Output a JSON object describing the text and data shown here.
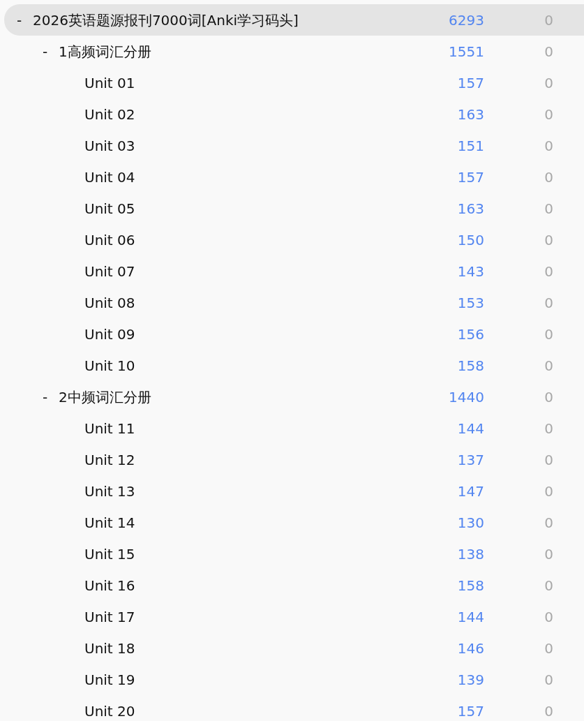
{
  "deck_list": {
    "decks": [
      {
        "toggle": "-",
        "name": "2026英语题源报刊7000词[Anki学习码头]",
        "count_1": "6293",
        "count_2": "0",
        "selected": true,
        "expanded": true,
        "children": [
          {
            "toggle": "-",
            "name": "1高频词汇分册",
            "count_1": "1551",
            "count_2": "0",
            "selected": false,
            "expanded": true,
            "children": [
              {
                "name": "Unit 01",
                "count_1": "157",
                "count_2": "0",
                "selected": false
              },
              {
                "name": "Unit 02",
                "count_1": "163",
                "count_2": "0",
                "selected": false
              },
              {
                "name": "Unit 03",
                "count_1": "151",
                "count_2": "0",
                "selected": false
              },
              {
                "name": "Unit 04",
                "count_1": "157",
                "count_2": "0",
                "selected": false
              },
              {
                "name": "Unit 05",
                "count_1": "163",
                "count_2": "0",
                "selected": false
              },
              {
                "name": "Unit 06",
                "count_1": "150",
                "count_2": "0",
                "selected": false
              },
              {
                "name": "Unit 07",
                "count_1": "143",
                "count_2": "0",
                "selected": false
              },
              {
                "name": "Unit 08",
                "count_1": "153",
                "count_2": "0",
                "selected": false
              },
              {
                "name": "Unit 09",
                "count_1": "156",
                "count_2": "0",
                "selected": false
              },
              {
                "name": "Unit 10",
                "count_1": "158",
                "count_2": "0",
                "selected": false
              }
            ]
          },
          {
            "toggle": "-",
            "name": "2中频词汇分册",
            "count_1": "1440",
            "count_2": "0",
            "selected": false,
            "expanded": true,
            "children": [
              {
                "name": "Unit 11",
                "count_1": "144",
                "count_2": "0",
                "selected": false
              },
              {
                "name": "Unit 12",
                "count_1": "137",
                "count_2": "0",
                "selected": false
              },
              {
                "name": "Unit 13",
                "count_1": "147",
                "count_2": "0",
                "selected": false
              },
              {
                "name": "Unit 14",
                "count_1": "130",
                "count_2": "0",
                "selected": false
              },
              {
                "name": "Unit 15",
                "count_1": "138",
                "count_2": "0",
                "selected": false
              },
              {
                "name": "Unit 16",
                "count_1": "158",
                "count_2": "0",
                "selected": false
              },
              {
                "name": "Unit 17",
                "count_1": "144",
                "count_2": "0",
                "selected": false
              },
              {
                "name": "Unit 18",
                "count_1": "146",
                "count_2": "0",
                "selected": false
              },
              {
                "name": "Unit 19",
                "count_1": "139",
                "count_2": "0",
                "selected": false
              },
              {
                "name": "Unit 20",
                "count_1": "157",
                "count_2": "0",
                "selected": false
              }
            ]
          }
        ]
      }
    ]
  }
}
